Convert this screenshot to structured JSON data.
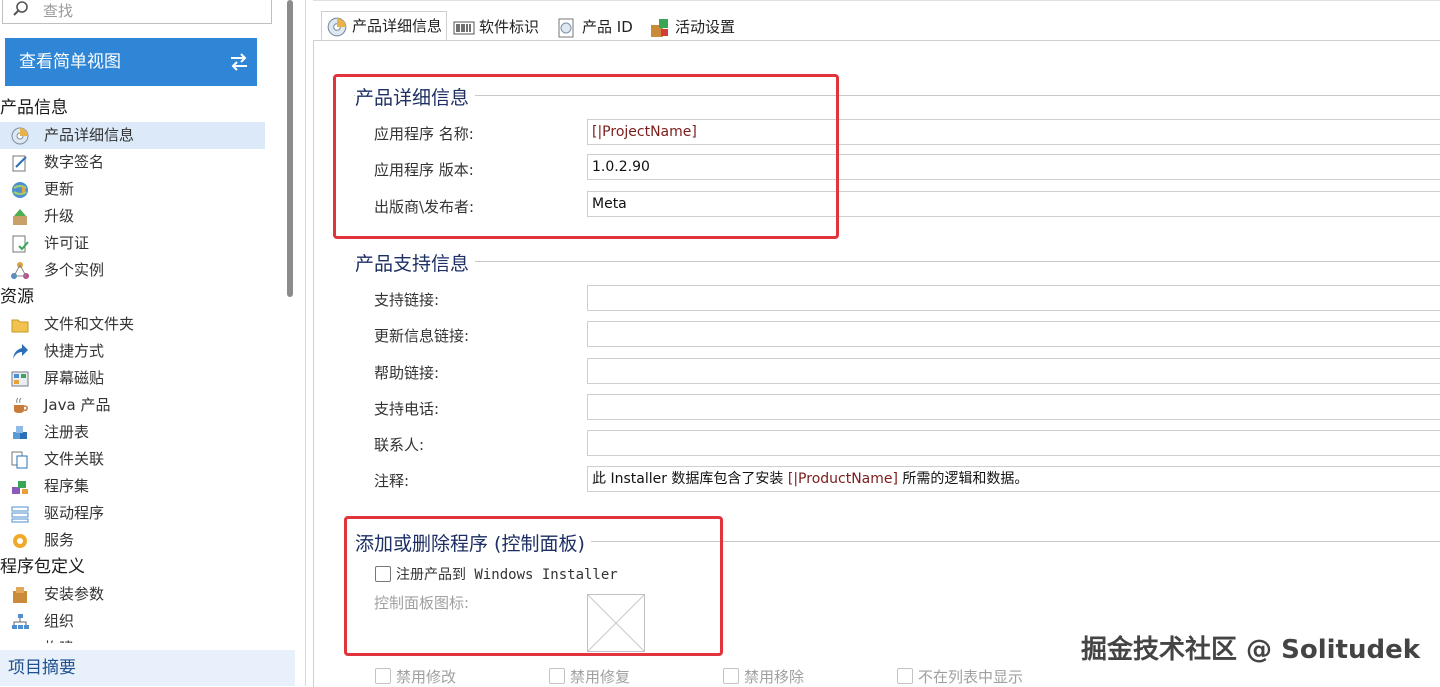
{
  "search": {
    "placeholder": "查找"
  },
  "sidebar": {
    "simple_view_label": "查看简单视图",
    "sections": [
      {
        "title": "产品信息",
        "items": [
          {
            "label": "产品详细信息",
            "icon": "product-details-icon",
            "selected": true
          },
          {
            "label": "数字签名",
            "icon": "signature-icon"
          },
          {
            "label": "更新",
            "icon": "globe-update-icon"
          },
          {
            "label": "升级",
            "icon": "upgrade-icon"
          },
          {
            "label": "许可证",
            "icon": "license-icon"
          },
          {
            "label": "多个实例",
            "icon": "instances-icon"
          }
        ]
      },
      {
        "title": "资源",
        "items": [
          {
            "label": "文件和文件夹",
            "icon": "folder-icon"
          },
          {
            "label": "快捷方式",
            "icon": "shortcut-arrow-icon"
          },
          {
            "label": "屏幕磁贴",
            "icon": "tiles-icon"
          },
          {
            "label": "Java 产品",
            "icon": "java-cup-icon"
          },
          {
            "label": "注册表",
            "icon": "registry-cubes-icon"
          },
          {
            "label": "文件关联",
            "icon": "file-assoc-icon"
          },
          {
            "label": "程序集",
            "icon": "assembly-icon"
          },
          {
            "label": "驱动程序",
            "icon": "driver-icon"
          },
          {
            "label": "服务",
            "icon": "service-gear-icon"
          }
        ]
      },
      {
        "title": "程序包定义",
        "items": [
          {
            "label": "安装参数",
            "icon": "install-params-icon"
          },
          {
            "label": "组织",
            "icon": "organization-icon"
          },
          {
            "label": "构建",
            "icon": "build-icon"
          }
        ]
      }
    ],
    "summary_label": "项目摘要"
  },
  "tabs": [
    {
      "label": "产品详细信息",
      "icon": "product-details-icon"
    },
    {
      "label": "软件标识",
      "icon": "barcode-icon"
    },
    {
      "label": "产品 ID",
      "icon": "product-id-icon"
    },
    {
      "label": "活动设置",
      "icon": "activity-settings-icon"
    }
  ],
  "product_details": {
    "title": "产品详细信息",
    "app_name_label": "应用程序 名称:",
    "app_name_value": "[|ProjectName]",
    "app_version_label": "应用程序 版本:",
    "app_version_value": "1.0.2.90",
    "publisher_label": "出版商\\发布者:",
    "publisher_value": "Meta"
  },
  "support_info": {
    "title": "产品支持信息",
    "support_link_label": "支持链接:",
    "update_link_label": "更新信息链接:",
    "help_link_label": "帮助链接:",
    "support_phone_label": "支持电话:",
    "contact_label": "联系人:",
    "comments_label": "注释:",
    "comments_value_prefix": "此 Installer 数据库包含了安装 ",
    "comments_value_token": "[|ProductName]",
    "comments_value_suffix": " 所需的逻辑和数据。"
  },
  "add_remove": {
    "title": "添加或删除程序 (控制面板)",
    "register_label": "注册产品到 Windows Installer",
    "icon_label": "控制面板图标:",
    "disable_modify": "禁用修改",
    "disable_repair": "禁用修复",
    "disable_remove": "禁用移除",
    "hide_in_list": "不在列表中显示"
  },
  "watermark": "掘金技术社区 @ Solitudek",
  "colors": {
    "accent": "#2f86d6",
    "highlight_box": "#e0333b",
    "group_title": "#1d2f63"
  }
}
